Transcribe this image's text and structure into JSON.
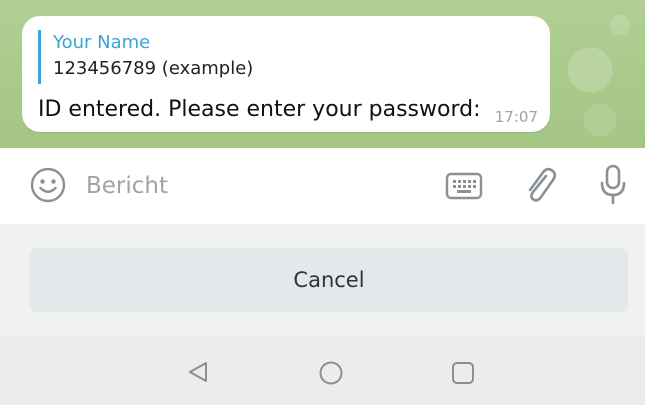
{
  "message": {
    "reply_name": "Your Name",
    "reply_text": "123456789 (example)",
    "text": "ID entered. Please enter your password:",
    "time": "17:07"
  },
  "input": {
    "placeholder": "Bericht",
    "value": ""
  },
  "keyboard": {
    "cancel_label": "Cancel"
  },
  "icons": {
    "emoji": "emoji-icon",
    "keyboard": "keyboard-icon",
    "attach": "paperclip-icon",
    "mic": "microphone-icon",
    "nav_back": "back-triangle-icon",
    "nav_home": "home-circle-icon",
    "nav_recent": "recents-square-icon"
  },
  "colors": {
    "accent": "#3ba5d5",
    "wallpaper": "#a7c68a",
    "bubble": "#ffffff"
  }
}
